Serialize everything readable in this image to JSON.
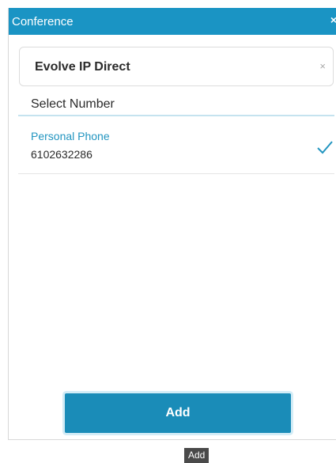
{
  "dialog": {
    "title": "Conference",
    "close_glyph": "×"
  },
  "contact": {
    "name": "Evolve IP Direct",
    "clear_glyph": "×"
  },
  "select_number": {
    "label": "Select Number",
    "items": [
      {
        "type": "Personal Phone",
        "number": "6102632286",
        "selected": true
      }
    ]
  },
  "actions": {
    "add_label": "Add"
  },
  "tooltip": {
    "text": "Add"
  },
  "colors": {
    "titlebar": "#1a94c4",
    "accent": "#2295c0",
    "button": "#1a8cb8"
  },
  "icons": {
    "close": "close-icon",
    "clear": "clear-icon",
    "check": "check-icon"
  }
}
